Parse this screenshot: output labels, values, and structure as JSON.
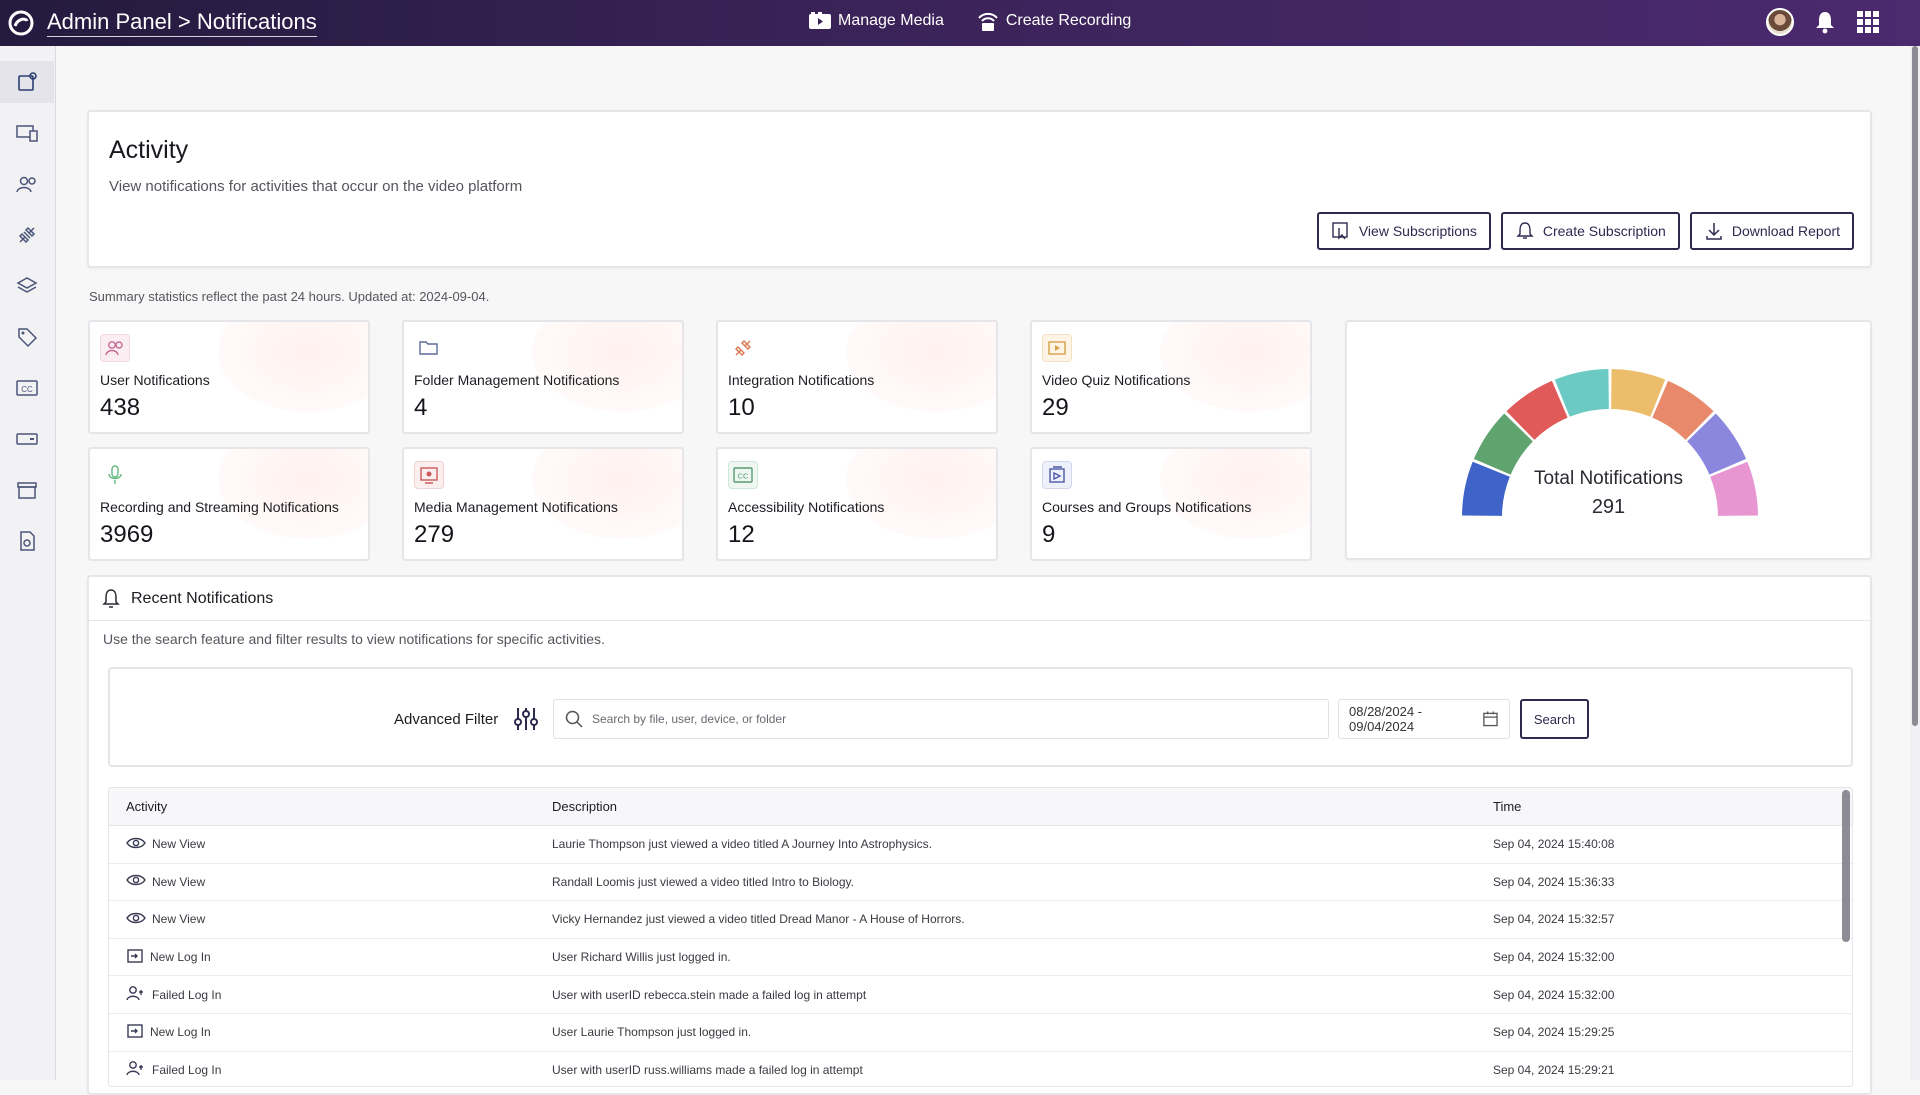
{
  "header": {
    "app": "Admin Panel",
    "separator": ">",
    "page": "Notifications",
    "nav": [
      {
        "label": "Manage Media",
        "icon": "film-icon"
      },
      {
        "label": "Create Recording",
        "icon": "broadcast-icon"
      }
    ]
  },
  "activity": {
    "title": "Activity",
    "description": "View notifications for activities that occur on the video platform",
    "buttons": {
      "view_subscriptions": "View Subscriptions",
      "create_subscription": "Create Subscription",
      "download_report": "Download Report"
    }
  },
  "summary_note": "Summary statistics reflect the past 24 hours. Updated at: 2024-09-04.",
  "stats": [
    {
      "label": "User Notifications",
      "value": "438",
      "icon": "users-icon"
    },
    {
      "label": "Folder Management Notifications",
      "value": "4",
      "icon": "folder-icon"
    },
    {
      "label": "Integration Notifications",
      "value": "10",
      "icon": "plug-icon"
    },
    {
      "label": "Video Quiz Notifications",
      "value": "29",
      "icon": "video-quiz-icon"
    },
    {
      "label": "Recording and Streaming Notifications",
      "value": "3969",
      "icon": "microphone-icon"
    },
    {
      "label": "Media Management Notifications",
      "value": "279",
      "icon": "media-icon"
    },
    {
      "label": "Accessibility Notifications",
      "value": "12",
      "icon": "closed-caption-icon"
    },
    {
      "label": "Courses and Groups Notifications",
      "value": "9",
      "icon": "courses-icon"
    }
  ],
  "gauge": {
    "title": "Total Notifications",
    "value": "291",
    "segment_colors": [
      "#3f63c8",
      "#5fa36e",
      "#e05a5a",
      "#6ccac4",
      "#ecbd6a",
      "#e7896a",
      "#8b87de",
      "#e896d2"
    ]
  },
  "recent": {
    "title": "Recent Notifications",
    "description": "Use the search feature and filter results to view notifications for specific activities.",
    "filter_label": "Advanced Filter",
    "search_placeholder": "Search by file, user, device, or folder",
    "date_range": "08/28/2024 - 09/04/2024",
    "search_button": "Search",
    "columns": {
      "activity": "Activity",
      "description": "Description",
      "time": "Time"
    },
    "rows": [
      {
        "activity": "New View",
        "icon": "eye-icon",
        "description": "Laurie Thompson just viewed a video titled A Journey Into Astrophysics.",
        "time": "Sep 04, 2024 15:40:08"
      },
      {
        "activity": "New View",
        "icon": "eye-icon",
        "description": "Randall Loomis just viewed a video titled Intro to Biology.",
        "time": "Sep 04, 2024 15:36:33"
      },
      {
        "activity": "New View",
        "icon": "eye-icon",
        "description": "Vicky Hernandez just viewed a video titled Dread Manor - A House of Horrors.",
        "time": "Sep 04, 2024 15:32:57"
      },
      {
        "activity": "New Log In",
        "icon": "login-icon",
        "description": "User Richard Willis just logged in.",
        "time": "Sep 04, 2024 15:32:00"
      },
      {
        "activity": "Failed Log In",
        "icon": "user-warning-icon",
        "description": "User with userID rebecca.stein made a failed log in attempt",
        "time": "Sep 04, 2024 15:32:00"
      },
      {
        "activity": "New Log In",
        "icon": "login-icon",
        "description": "User Laurie Thompson just logged in.",
        "time": "Sep 04, 2024 15:29:25"
      },
      {
        "activity": "Failed Log In",
        "icon": "user-warning-icon",
        "description": "User with userID russ.williams made a failed log in attempt",
        "time": "Sep 04, 2024 15:29:21"
      }
    ]
  }
}
